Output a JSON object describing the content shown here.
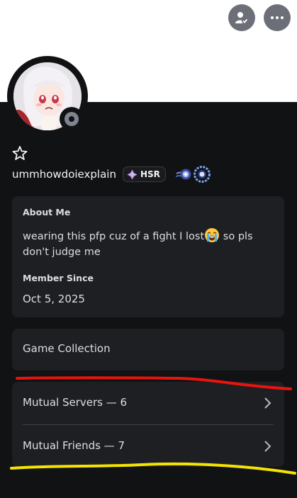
{
  "profile": {
    "username": "ummhowdoiexplain",
    "tag": "HSR"
  },
  "about": {
    "heading": "About Me",
    "text_before_emoji": "wearing this pfp cuz of a fight I lost",
    "emoji": "loudly-crying-face",
    "text_after_emoji": " so pls don't judge me",
    "member_heading": "Member Since",
    "member_date": "Oct 5, 2025"
  },
  "sections": {
    "game_collection": "Game Collection",
    "mutual_servers": "Mutual Servers — 6",
    "mutual_friends": "Mutual Friends — 7"
  },
  "icons": {
    "friend_request": "person-check-icon",
    "more": "ellipsis-icon",
    "status": "offline-status",
    "star": "star-outline-icon",
    "chevron": "chevron-right-icon"
  },
  "colors": {
    "panel": "#111214",
    "card": "#1e1f22",
    "text": "#dbdee1",
    "button": "#6d6f78",
    "annotation_red": "#e8140e",
    "annotation_yellow": "#f4e400"
  }
}
